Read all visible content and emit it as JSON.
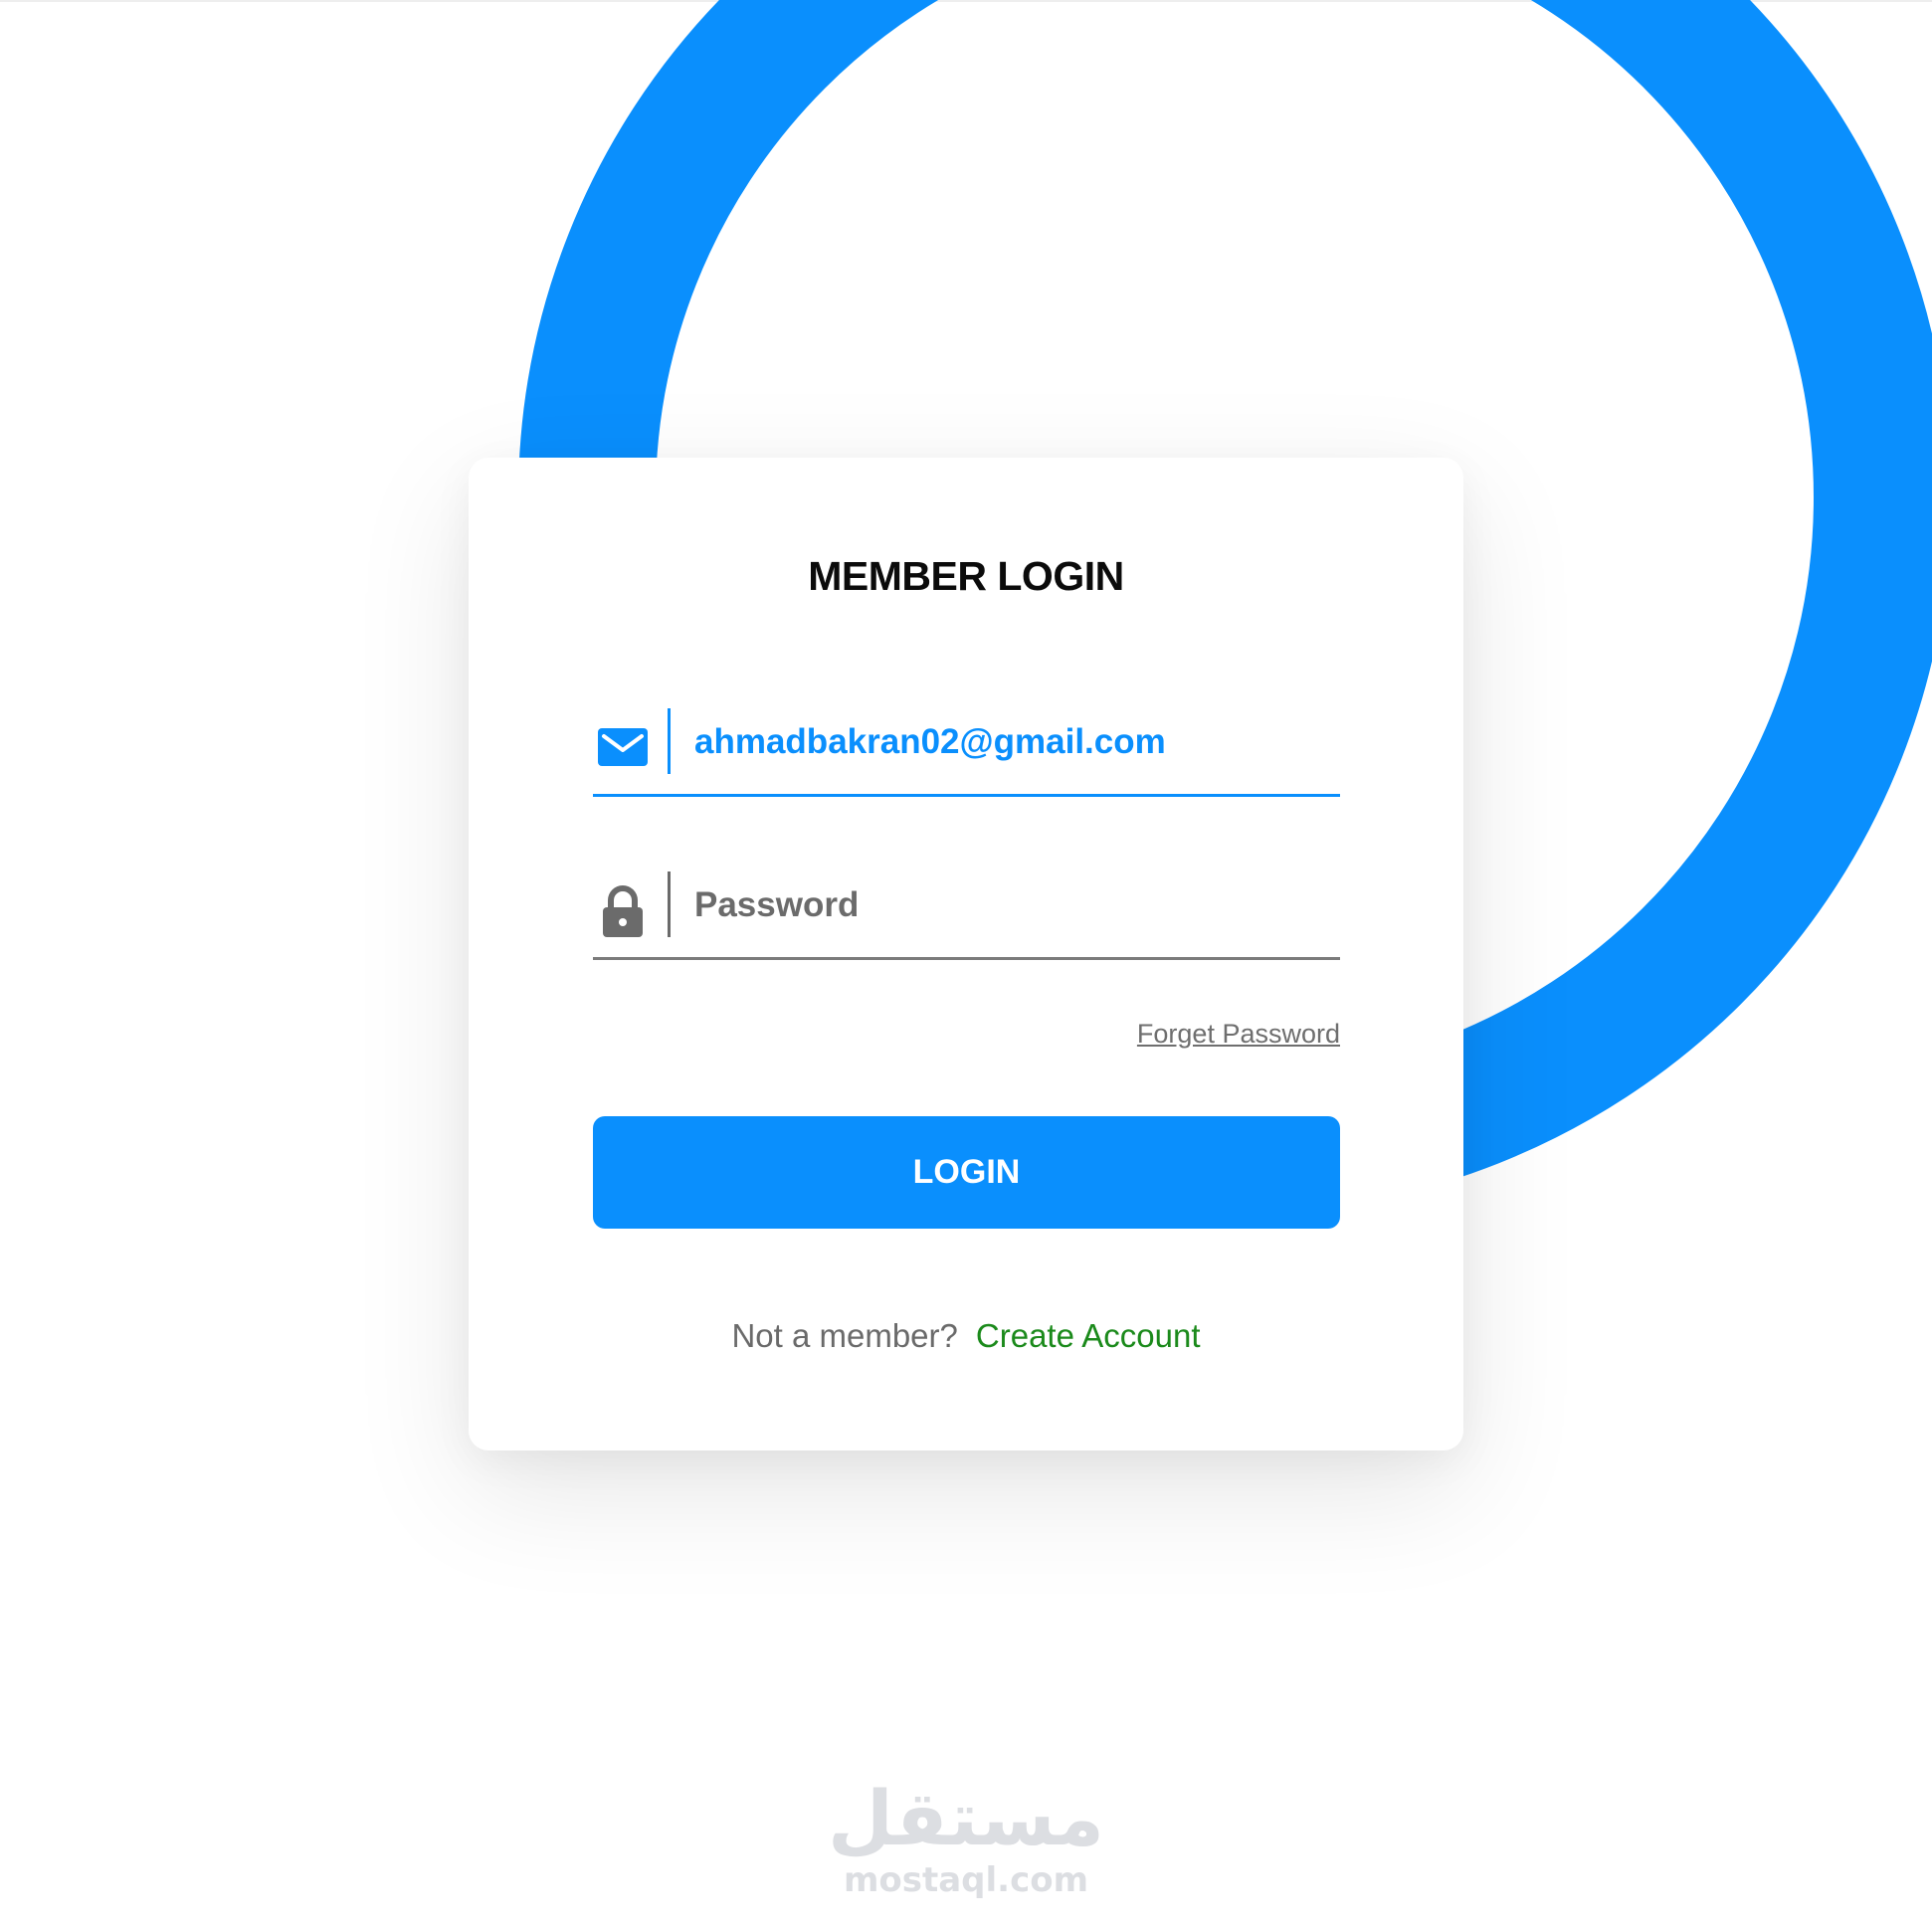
{
  "login": {
    "title": "MEMBER LOGIN",
    "email": {
      "value": "ahmadbakran02@gmail.com",
      "icon": "mail-icon"
    },
    "password": {
      "placeholder": "Password",
      "icon": "lock-icon"
    },
    "forget_password": "Forget Password",
    "login_button": "LOGIN",
    "not_member": "Not a member?",
    "create_account": "Create Account"
  },
  "watermark": {
    "logo": "مستقل",
    "domain": "mostaql.com"
  },
  "colors": {
    "accent": "#0a8ffd",
    "link_green": "#1b8a1b",
    "muted": "#6a6a6a"
  }
}
